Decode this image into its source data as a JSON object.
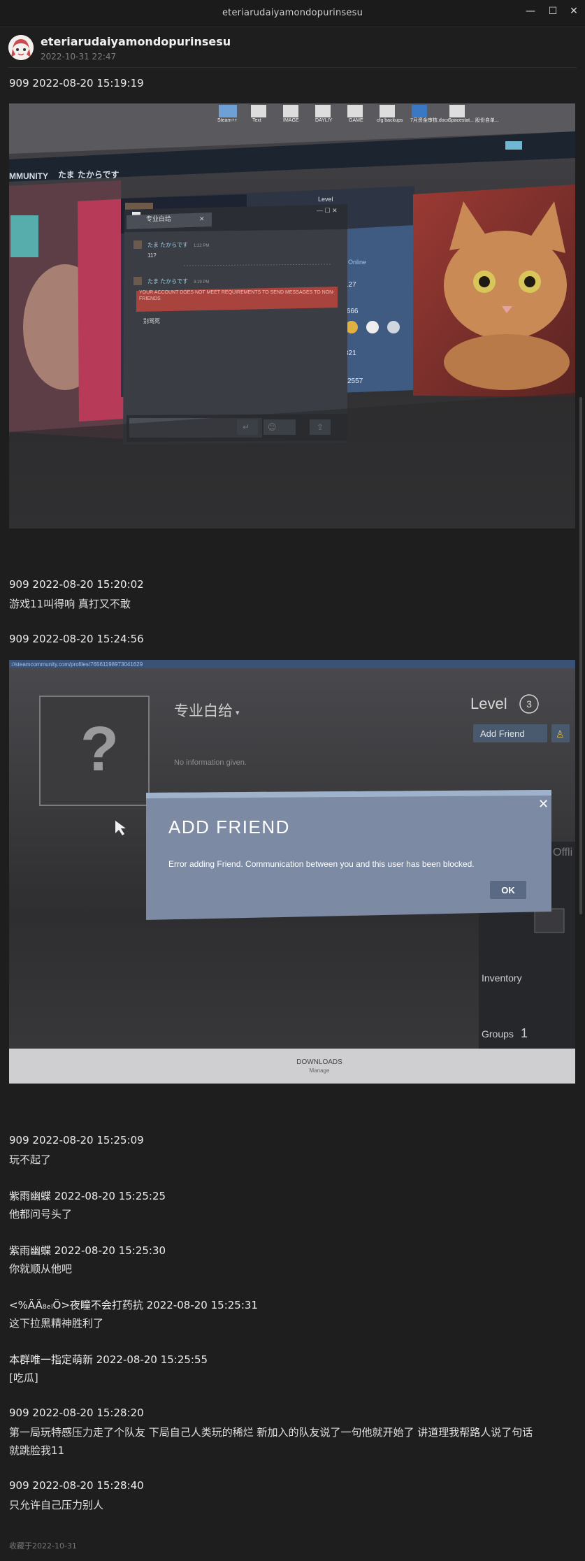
{
  "window": {
    "title": "eteriarudaiyamondopurinsesu",
    "minimize": "—",
    "maximize": "☐",
    "close": "✕"
  },
  "header": {
    "name": "eteriarudaiyamondopurinsesu",
    "date": "2022-10-31 22:47"
  },
  "photo1": {
    "desktop_icons": [
      "Steam++",
      "Text",
      "IMAGE",
      "DAYLIY",
      "GAME",
      "cfg backups",
      "7月资金审核.docx",
      "Spacestat... 股份自单..."
    ],
    "community_label": "MMUNITY",
    "profile_name": "たま たからです",
    "chat_window_title": "专业白给",
    "chat_msg1_sender": "たま たからです",
    "chat_msg1_time": "1:22 PM",
    "chat_msg1_text": "11?",
    "chat_msg2_sender": "たま たからです",
    "chat_msg2_time": "3:19 PM",
    "chat_error": "YOUR ACCOUNT DOES NOT MEET REQUIREMENTS TO SEND MESSAGES TO NON-FRIENDS",
    "chat_error_sub": "别骂死",
    "level_text": "Level",
    "online_text": "y Online",
    "stat1": "127",
    "stat2": ",666",
    "stat3": "321",
    "stat4": "2557"
  },
  "photo2": {
    "url": "://steamcommunity.com/profiles/76561198973041629",
    "profile_name": "专业白给",
    "no_info": "No information given.",
    "level_label": "Level",
    "level_value": "3",
    "add_friend": "Add Friend",
    "dialog_title": "ADD FRIEND",
    "dialog_message": "Error adding Friend. Communication between you and this user has been blocked.",
    "ok": "OK",
    "offline": "Offli",
    "inventory": "Inventory",
    "groups": "Groups",
    "groups_count": "1",
    "downloads": "DOWNLOADS",
    "manage": "Manage"
  },
  "messages": [
    {
      "time": "909 2022-08-20 15:19:19",
      "text": ""
    },
    {
      "time": "909 2022-08-20 15:20:02",
      "text": "游戏11叫得响 真打又不敢"
    },
    {
      "time": "909 2022-08-20 15:24:56",
      "text": ""
    },
    {
      "time": "909 2022-08-20 15:25:09",
      "text": "玩不起了"
    },
    {
      "time": "紫雨幽蝶 2022-08-20 15:25:25",
      "text": "他都问号头了"
    },
    {
      "time": "紫雨幽蝶 2022-08-20 15:25:30",
      "text": "你就顺从他吧"
    },
    {
      "time": "<%ÄÄ₈ₑₗÖ>夜瞳不会打药抗 2022-08-20 15:25:31",
      "text": "这下拉黑精神胜利了"
    },
    {
      "time": "本群唯一指定萌新 2022-08-20 15:25:55",
      "text": "[吃瓜]"
    },
    {
      "time": "909 2022-08-20 15:28:20",
      "text": "第一局玩特感压力走了个队友 下局自己人类玩的稀烂 新加入的队友说了一句他就开始了 讲道理我帮路人说了句话",
      "text2": "就跳脸我11"
    },
    {
      "time": "909 2022-08-20 15:28:40",
      "text": " 只允许自己压力别人"
    }
  ],
  "footer": "收藏于2022-10-31",
  "colors": {
    "background": "#1e1e1e",
    "text": "#e6e6e6",
    "steam_blue": "#67c1f5",
    "error_red": "#b53a36"
  }
}
